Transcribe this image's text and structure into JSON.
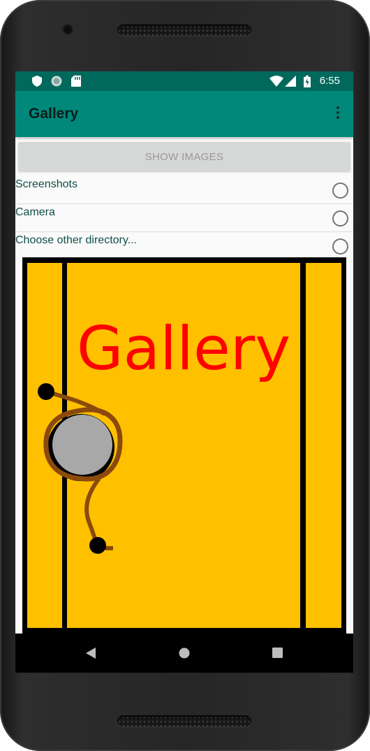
{
  "status_bar": {
    "time": "6:55",
    "icons": [
      "shield-icon",
      "sync-icon",
      "sd-card-icon",
      "wifi-icon",
      "signal-icon",
      "battery-icon"
    ]
  },
  "app_bar": {
    "title": "Gallery",
    "menu_icon": "more-vert-icon"
  },
  "show_images_button": {
    "label": "SHOW IMAGES"
  },
  "directories": [
    {
      "label": "Screenshots",
      "selected": false
    },
    {
      "label": "Camera",
      "selected": false
    },
    {
      "label": "Choose other directory...",
      "selected": false
    }
  ],
  "artwork": {
    "title_text": "Gallery",
    "background_color": "#ffc000",
    "title_color": "#ff0000"
  },
  "nav_bar": {
    "icons": [
      "back-icon",
      "home-icon",
      "recents-icon"
    ]
  },
  "colors": {
    "status_bar": "#00695c",
    "app_bar": "#00897b",
    "accent_text": "#0f4f47"
  }
}
